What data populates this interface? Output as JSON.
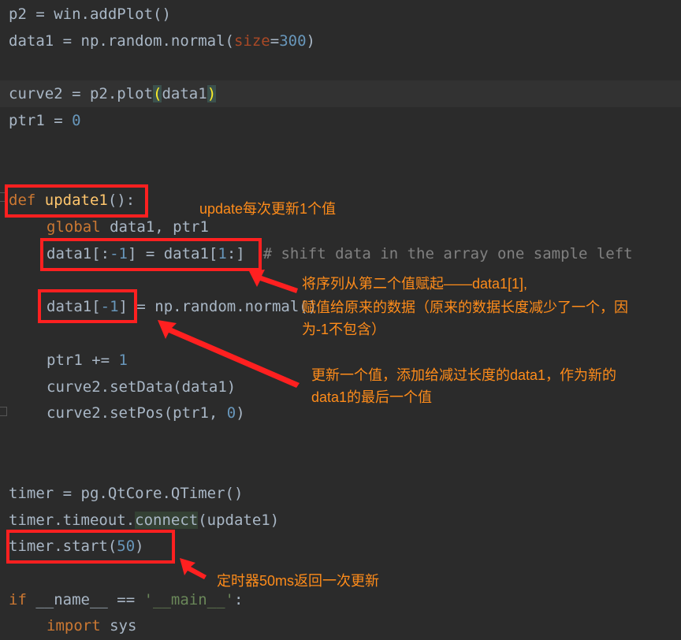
{
  "code": {
    "l1": {
      "a": "p2 = win.addPlot()"
    },
    "l2": {
      "a": "data1 = np.random.normal(",
      "param": "size",
      "eq": "=",
      "num": "300",
      "end": ")"
    },
    "l3": {
      "a": "curve2 = p2.plot",
      "p1": "(",
      "b": "data1",
      "p2": ")"
    },
    "l4": {
      "a": "ptr1 = ",
      "num": "0"
    },
    "l5": {
      "kw": "def",
      "sp": " ",
      "fn": "update1",
      "end": "():"
    },
    "l6": {
      "kw": "global",
      "rest": " data1, ptr1"
    },
    "l7": {
      "a": "data1[:",
      "num1": "-1",
      "b": "] = data1[",
      "num2": "1",
      "c": ":]",
      "cmt": "  # shift data in the array one sample left"
    },
    "l8": {
      "a": "data1[",
      "num": "-1",
      "b": "] = np.random.normal()"
    },
    "l9": {
      "a": "ptr1 += ",
      "num": "1"
    },
    "l10": {
      "a": "curve2.setData(data1)"
    },
    "l11": {
      "a": "curve2.setPos(ptr1, ",
      "num": "0",
      "end": ")"
    },
    "l12": {
      "a": "timer = pg.QtCore.QTimer()"
    },
    "l13": {
      "a": "timer.timeout.",
      "hl": "connect",
      "b": "(update1)"
    },
    "l14": {
      "a": "timer.start(",
      "num": "50",
      "end": ")"
    },
    "l15": {
      "kw": "if",
      "a": " __name__ == ",
      "str": "'__main__'",
      "end": ":"
    },
    "l16": {
      "kw": "import",
      "rest": " sys"
    }
  },
  "annotations": {
    "a1": "update每次更新1个值",
    "a2_line1": "将序列从第二个值赋起——data1[1],",
    "a2_line2": "赋值给原来的数据（原来的数据长度减少了一个，因",
    "a2_line3": "为-1不包含）",
    "a3_line1": "更新一个值，添加给减过长度的data1，作为新的",
    "a3_line2": "data1的最后一个值",
    "a4": "定时器50ms返回一次更新"
  },
  "colors": {
    "background": "#2b2b2b",
    "text": "#a9b7c6",
    "keyword": "#cc7832",
    "number": "#6897bb",
    "annotation": "#ff8c1a",
    "box": "#ff2020"
  }
}
